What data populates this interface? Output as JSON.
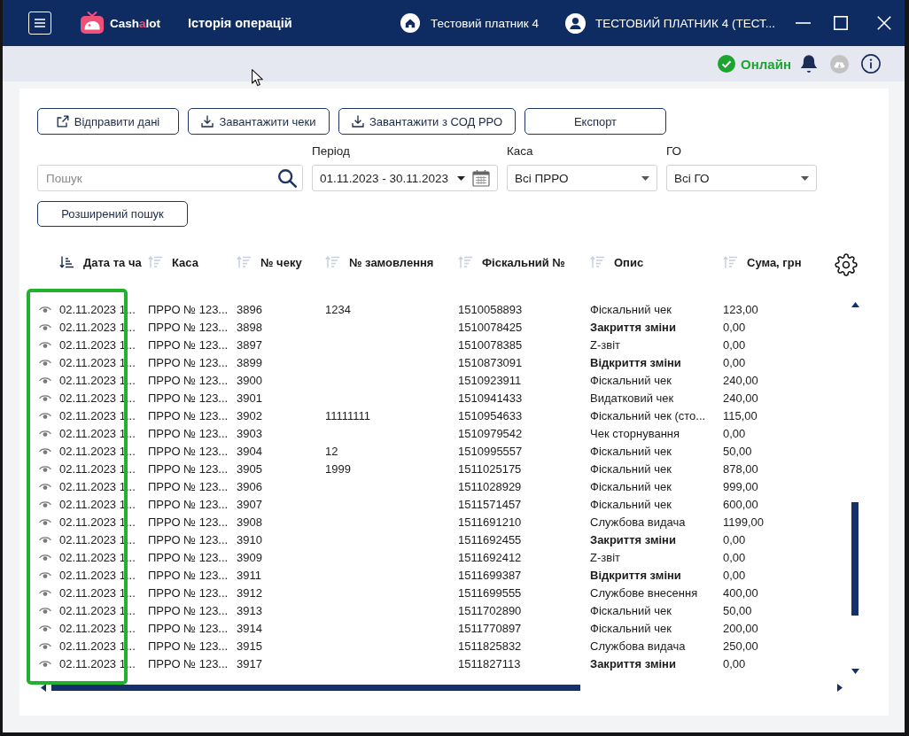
{
  "app": {
    "logo": [
      {
        "text": "Cash",
        "accent": false
      },
      {
        "text": "a",
        "accent": true
      },
      {
        "text": "lot",
        "accent": false
      }
    ],
    "title": "Історія операцій",
    "company": "Тестовий платник 4",
    "user": "ТЕСТОВИЙ ПЛАТНИК 4 (ТЕСТ..."
  },
  "status": {
    "label": "Онлайн",
    "online": true
  },
  "actions": [
    {
      "label": "Відправити дані",
      "kind": "send"
    },
    {
      "label": "Завантажити чеки",
      "kind": "download"
    },
    {
      "label": "Завантажити з СОД РРО",
      "kind": "download"
    },
    {
      "label": "Експорт",
      "kind": "plain"
    }
  ],
  "search": {
    "placeholder": "Пошук"
  },
  "filters": [
    {
      "label": "Період",
      "value": "01.11.2023 - 30.11.2023",
      "kind": "date-range"
    },
    {
      "label": "Каса",
      "value": "Всі ПРРО",
      "kind": "select"
    },
    {
      "label": "ГО",
      "value": "Всі ГО",
      "kind": "select"
    }
  ],
  "advanced_search": {
    "label": "Розширений пошук"
  },
  "table": {
    "columns": [
      {
        "label": "Дата та ча",
        "sorted": true
      },
      {
        "label": "Каса",
        "sorted": false
      },
      {
        "label": "№ чеку",
        "sorted": false
      },
      {
        "label": "№ замовлення",
        "sorted": false
      },
      {
        "label": "Фіскальний №",
        "sorted": false
      },
      {
        "label": "Опис",
        "sorted": false
      },
      {
        "label": "Сума, грн",
        "sorted": false
      }
    ],
    "rows": [
      {
        "date": "02.11.2023 1...",
        "register": "ПРРО № 123...",
        "receipt_no": "3896",
        "order_no": "1234",
        "fiscal_no": "1510058893",
        "description": "Фіскальний чек",
        "bold": false,
        "amount": "123,00"
      },
      {
        "date": "02.11.2023 1...",
        "register": "ПРРО № 123...",
        "receipt_no": "3898",
        "fiscal_no": "1510078425",
        "description": "Закриття зміни",
        "bold": true,
        "amount": "0,00"
      },
      {
        "date": "02.11.2023 1...",
        "register": "ПРРО № 123...",
        "receipt_no": "3897",
        "fiscal_no": "1510078385",
        "description": "Z-звіт",
        "bold": false,
        "amount": "0,00"
      },
      {
        "date": "02.11.2023 1...",
        "register": "ПРРО № 123...",
        "receipt_no": "3899",
        "fiscal_no": "1510873091",
        "description": "Відкриття зміни",
        "bold": true,
        "amount": "0,00"
      },
      {
        "date": "02.11.2023 1...",
        "register": "ПРРО № 123...",
        "receipt_no": "3900",
        "fiscal_no": "1510923911",
        "description": "Фіскальний чек",
        "bold": false,
        "amount": "240,00"
      },
      {
        "date": "02.11.2023 1...",
        "register": "ПРРО № 123...",
        "receipt_no": "3901",
        "fiscal_no": "1510941433",
        "description": "Видатковий чек",
        "bold": false,
        "amount": "240,00"
      },
      {
        "date": "02.11.2023 1...",
        "register": "ПРРО № 123...",
        "receipt_no": "3902",
        "order_no": "11111111",
        "fiscal_no": "1510954633",
        "description": "Фіскальний чек (сто...",
        "bold": false,
        "amount": "115,00"
      },
      {
        "date": "02.11.2023 1...",
        "register": "ПРРО № 123...",
        "receipt_no": "3903",
        "fiscal_no": "1510979542",
        "description": "Чек сторнування",
        "bold": false,
        "amount": "0,00"
      },
      {
        "date": "02.11.2023 1...",
        "register": "ПРРО № 123...",
        "receipt_no": "3904",
        "order_no": "12",
        "fiscal_no": "1510995557",
        "description": "Фіскальний чек",
        "bold": false,
        "amount": "50,00"
      },
      {
        "date": "02.11.2023 1...",
        "register": "ПРРО № 123...",
        "receipt_no": "3905",
        "order_no": "1999",
        "fiscal_no": "1511025175",
        "description": "Фіскальний чек",
        "bold": false,
        "amount": "878,00"
      },
      {
        "date": "02.11.2023 1...",
        "register": "ПРРО № 123...",
        "receipt_no": "3906",
        "fiscal_no": "1511028929",
        "description": "Фіскальний чек",
        "bold": false,
        "amount": "999,00"
      },
      {
        "date": "02.11.2023 1...",
        "register": "ПРРО № 123...",
        "receipt_no": "3907",
        "fiscal_no": "1511571457",
        "description": "Фіскальний чек",
        "bold": false,
        "amount": "600,00"
      },
      {
        "date": "02.11.2023 1...",
        "register": "ПРРО № 123...",
        "receipt_no": "3908",
        "fiscal_no": "1511691210",
        "description": "Службова видача",
        "bold": false,
        "amount": "1199,00"
      },
      {
        "date": "02.11.2023 1...",
        "register": "ПРРО № 123...",
        "receipt_no": "3910",
        "fiscal_no": "1511692455",
        "description": "Закриття зміни",
        "bold": true,
        "amount": "0,00"
      },
      {
        "date": "02.11.2023 1...",
        "register": "ПРРО № 123...",
        "receipt_no": "3909",
        "fiscal_no": "1511692412",
        "description": "Z-звіт",
        "bold": false,
        "amount": "0,00"
      },
      {
        "date": "02.11.2023 1...",
        "register": "ПРРО № 123...",
        "receipt_no": "3911",
        "fiscal_no": "1511699387",
        "description": "Відкриття зміни",
        "bold": true,
        "amount": "0,00"
      },
      {
        "date": "02.11.2023 1...",
        "register": "ПРРО № 123...",
        "receipt_no": "3912",
        "fiscal_no": "1511699555",
        "description": "Службове внесення",
        "bold": false,
        "amount": "400,00"
      },
      {
        "date": "02.11.2023 1...",
        "register": "ПРРО № 123...",
        "receipt_no": "3913",
        "fiscal_no": "1511702890",
        "description": "Фіскальний чек",
        "bold": false,
        "amount": "50,00"
      },
      {
        "date": "02.11.2023 1...",
        "register": "ПРРО № 123...",
        "receipt_no": "3914",
        "fiscal_no": "1511770897",
        "description": "Фіскальний чек",
        "bold": false,
        "amount": "200,00"
      },
      {
        "date": "02.11.2023 1...",
        "register": "ПРРО № 123...",
        "receipt_no": "3915",
        "fiscal_no": "1511825832",
        "description": "Службова видача",
        "bold": false,
        "amount": "250,00"
      },
      {
        "date": "02.11.2023 1...",
        "register": "ПРРО № 123...",
        "receipt_no": "3917",
        "fiscal_no": "1511827113",
        "description": "Закриття зміни",
        "bold": true,
        "amount": "0,00"
      }
    ]
  }
}
